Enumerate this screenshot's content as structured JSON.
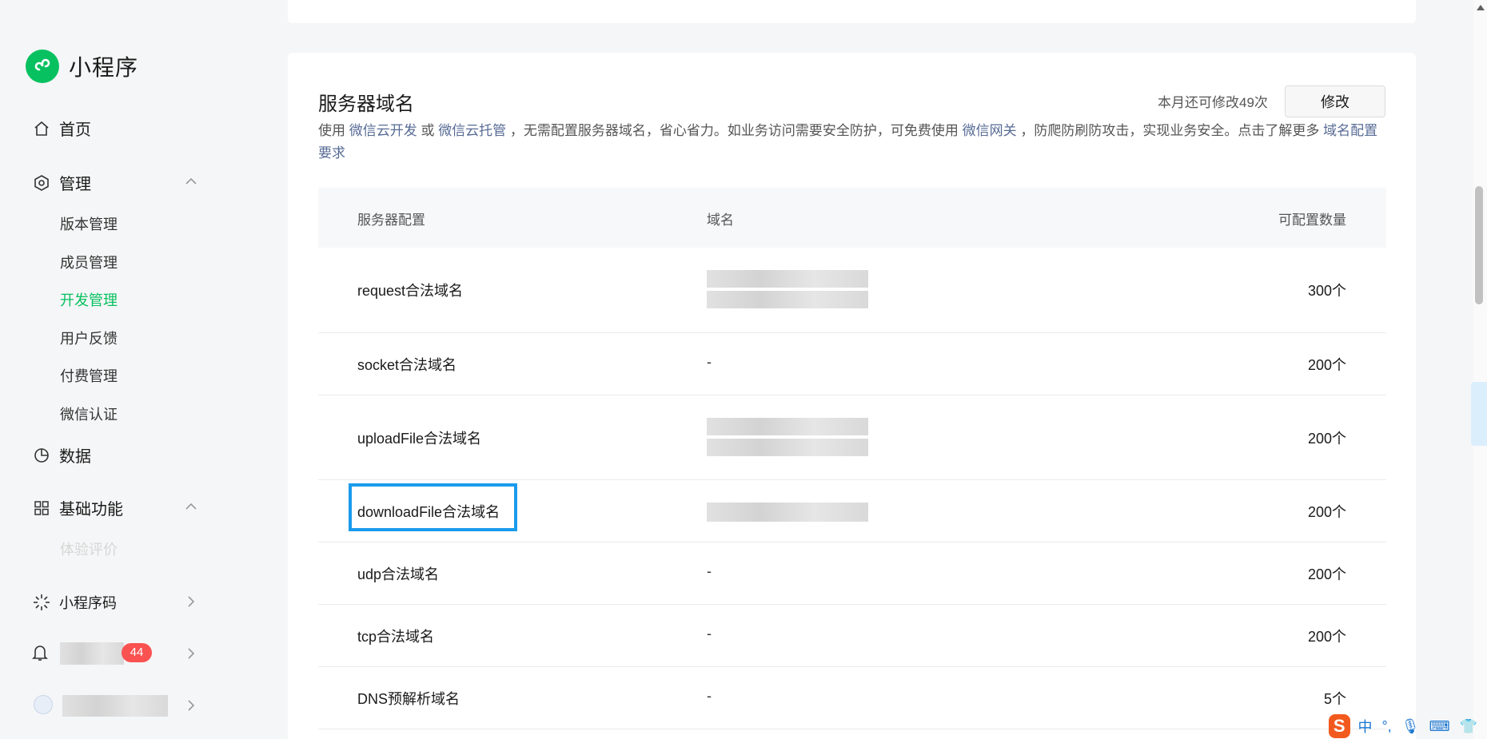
{
  "app": {
    "title": "小程序"
  },
  "nav": {
    "home": "首页",
    "manage": "管理",
    "manage_items": [
      "版本管理",
      "成员管理",
      "开发管理",
      "用户反馈",
      "付费管理",
      "微信认证"
    ],
    "data": "数据",
    "basic": "基础功能",
    "basic_items": [
      "体验评价"
    ],
    "qrcode": "小程序码",
    "notify_badge": "44"
  },
  "server": {
    "title": "服务器域名",
    "remain": "本月还可修改49次",
    "edit_label": "修改",
    "desc": {
      "p1": "使用 ",
      "l1": "微信云开发",
      "p2": " 或 ",
      "l2": "微信云托管",
      "p3": " ，无需配置服务器域名，省心省力。如业务访问需要安全防护，可免费使用 ",
      "l3": "微信网关",
      "p4": " ，防爬防刷防攻击，实现业务安全。点击了解更多 ",
      "l4": "域名配置要求"
    },
    "columns": [
      "服务器配置",
      "域名",
      "可配置数量"
    ],
    "rows": [
      {
        "name": "request合法域名",
        "domain": "",
        "count": "300个"
      },
      {
        "name": "socket合法域名",
        "domain": "-",
        "count": "200个"
      },
      {
        "name": "uploadFile合法域名",
        "domain": "",
        "count": "200个"
      },
      {
        "name": "downloadFile合法域名",
        "domain": "",
        "count": "200个"
      },
      {
        "name": "udp合法域名",
        "domain": "-",
        "count": "200个"
      },
      {
        "name": "tcp合法域名",
        "domain": "-",
        "count": "200个"
      },
      {
        "name": "DNS预解析域名",
        "domain": "-",
        "count": "5个"
      }
    ]
  },
  "ime": {
    "logo": "S",
    "mode": "中",
    "punct": "°,",
    "mic": "🎙",
    "kbd": "⌨",
    "shirt": "👕"
  }
}
